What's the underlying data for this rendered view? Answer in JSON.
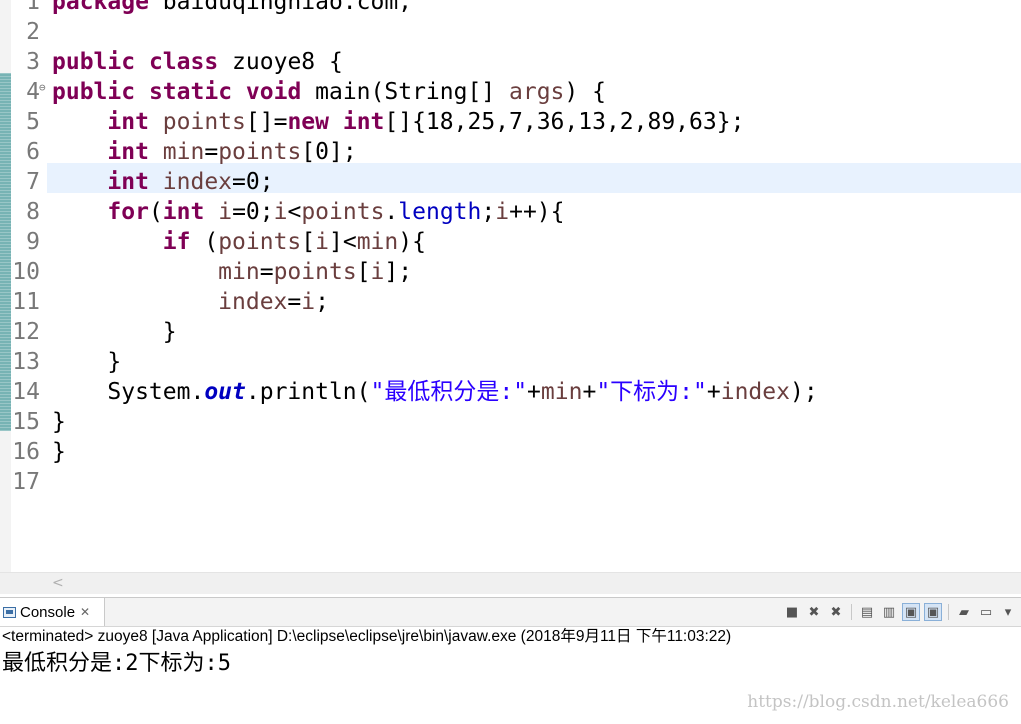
{
  "editor": {
    "lines": [
      {
        "num": "1",
        "tokens": [
          {
            "t": "package",
            "c": "kw"
          },
          {
            "t": " baiduqinghiao.com;",
            "c": "plain"
          }
        ]
      },
      {
        "num": "2",
        "tokens": []
      },
      {
        "num": "3",
        "tokens": [
          {
            "t": "public",
            "c": "kw"
          },
          {
            "t": " ",
            "c": "plain"
          },
          {
            "t": "class",
            "c": "kw"
          },
          {
            "t": " zuoye8 {",
            "c": "plain"
          }
        ]
      },
      {
        "num": "4",
        "fold": true,
        "tokens": [
          {
            "t": "public",
            "c": "kw"
          },
          {
            "t": " ",
            "c": "plain"
          },
          {
            "t": "static",
            "c": "kw"
          },
          {
            "t": " ",
            "c": "plain"
          },
          {
            "t": "void",
            "c": "kw"
          },
          {
            "t": " main(String[] ",
            "c": "plain"
          },
          {
            "t": "args",
            "c": "var"
          },
          {
            "t": ") {",
            "c": "plain"
          }
        ]
      },
      {
        "num": "5",
        "tokens": [
          {
            "t": "    ",
            "c": "plain"
          },
          {
            "t": "int",
            "c": "kw"
          },
          {
            "t": " ",
            "c": "plain"
          },
          {
            "t": "points",
            "c": "var"
          },
          {
            "t": "[]=",
            "c": "plain"
          },
          {
            "t": "new",
            "c": "kw"
          },
          {
            "t": " ",
            "c": "plain"
          },
          {
            "t": "int",
            "c": "kw"
          },
          {
            "t": "[]{18,25,7,36,13,2,89,63};",
            "c": "plain"
          }
        ]
      },
      {
        "num": "6",
        "tokens": [
          {
            "t": "    ",
            "c": "plain"
          },
          {
            "t": "int",
            "c": "kw"
          },
          {
            "t": " ",
            "c": "plain"
          },
          {
            "t": "min",
            "c": "var"
          },
          {
            "t": "=",
            "c": "plain"
          },
          {
            "t": "points",
            "c": "var"
          },
          {
            "t": "[0];",
            "c": "plain"
          }
        ]
      },
      {
        "num": "7",
        "current": true,
        "tokens": [
          {
            "t": "    ",
            "c": "plain"
          },
          {
            "t": "int",
            "c": "kw"
          },
          {
            "t": " ",
            "c": "plain"
          },
          {
            "t": "index",
            "c": "var"
          },
          {
            "t": "=0;",
            "c": "plain"
          }
        ]
      },
      {
        "num": "8",
        "tokens": [
          {
            "t": "    ",
            "c": "plain"
          },
          {
            "t": "for",
            "c": "kw"
          },
          {
            "t": "(",
            "c": "plain"
          },
          {
            "t": "int",
            "c": "kw"
          },
          {
            "t": " ",
            "c": "plain"
          },
          {
            "t": "i",
            "c": "var"
          },
          {
            "t": "=0;",
            "c": "plain"
          },
          {
            "t": "i",
            "c": "var"
          },
          {
            "t": "<",
            "c": "plain"
          },
          {
            "t": "points",
            "c": "var"
          },
          {
            "t": ".",
            "c": "plain"
          },
          {
            "t": "length",
            "c": "field"
          },
          {
            "t": ";",
            "c": "plain"
          },
          {
            "t": "i",
            "c": "var"
          },
          {
            "t": "++){",
            "c": "plain"
          }
        ]
      },
      {
        "num": "9",
        "tokens": [
          {
            "t": "        ",
            "c": "plain"
          },
          {
            "t": "if",
            "c": "kw"
          },
          {
            "t": " (",
            "c": "plain"
          },
          {
            "t": "points",
            "c": "var"
          },
          {
            "t": "[",
            "c": "plain"
          },
          {
            "t": "i",
            "c": "var"
          },
          {
            "t": "]<",
            "c": "plain"
          },
          {
            "t": "min",
            "c": "var"
          },
          {
            "t": "){",
            "c": "plain"
          }
        ]
      },
      {
        "num": "10",
        "tokens": [
          {
            "t": "            ",
            "c": "plain"
          },
          {
            "t": "min",
            "c": "var"
          },
          {
            "t": "=",
            "c": "plain"
          },
          {
            "t": "points",
            "c": "var"
          },
          {
            "t": "[",
            "c": "plain"
          },
          {
            "t": "i",
            "c": "var"
          },
          {
            "t": "];",
            "c": "plain"
          }
        ]
      },
      {
        "num": "11",
        "tokens": [
          {
            "t": "            ",
            "c": "plain"
          },
          {
            "t": "index",
            "c": "var"
          },
          {
            "t": "=",
            "c": "plain"
          },
          {
            "t": "i",
            "c": "var"
          },
          {
            "t": ";",
            "c": "plain"
          }
        ]
      },
      {
        "num": "12",
        "tokens": [
          {
            "t": "        }",
            "c": "plain"
          }
        ]
      },
      {
        "num": "13",
        "tokens": [
          {
            "t": "    }",
            "c": "plain"
          }
        ]
      },
      {
        "num": "14",
        "tokens": [
          {
            "t": "    System.",
            "c": "plain"
          },
          {
            "t": "out",
            "c": "sfield"
          },
          {
            "t": ".println(",
            "c": "plain"
          },
          {
            "t": "\"最低积分是:\"",
            "c": "str"
          },
          {
            "t": "+",
            "c": "plain"
          },
          {
            "t": "min",
            "c": "var"
          },
          {
            "t": "+",
            "c": "plain"
          },
          {
            "t": "\"下标为:\"",
            "c": "str"
          },
          {
            "t": "+",
            "c": "plain"
          },
          {
            "t": "index",
            "c": "var"
          },
          {
            "t": ");",
            "c": "plain"
          }
        ]
      },
      {
        "num": "15",
        "tokens": [
          {
            "t": "}",
            "c": "plain"
          }
        ]
      },
      {
        "num": "16",
        "tokens": [
          {
            "t": "}",
            "c": "plain"
          }
        ]
      },
      {
        "num": "17",
        "tokens": []
      }
    ]
  },
  "console": {
    "tab_label": "Console",
    "status": "<terminated> zuoye8 [Java Application] D:\\eclipse\\eclipse\\jre\\bin\\javaw.exe (2018年9月11日 下午11:03:22)",
    "output_parts": [
      {
        "t": "最低积分是",
        "f": "cjk"
      },
      {
        "t": ":2",
        "f": "mono"
      },
      {
        "t": "下标为",
        "f": "cjk"
      },
      {
        "t": ":5",
        "f": "mono"
      }
    ],
    "toolbar_icons": [
      {
        "name": "terminate-icon",
        "glyph": "■",
        "sep_after": false
      },
      {
        "name": "remove-launch-icon",
        "glyph": "✖",
        "sep_after": false
      },
      {
        "name": "remove-all-terminated-icon",
        "glyph": "✖",
        "sep_after": true
      },
      {
        "name": "clear-console-icon",
        "glyph": "▤",
        "sep_after": false
      },
      {
        "name": "scroll-lock-icon",
        "glyph": "▥",
        "sep_after": false
      },
      {
        "name": "show-on-stdout-icon",
        "glyph": "▣",
        "sep_after": false,
        "selected": true
      },
      {
        "name": "show-on-stderr-icon",
        "glyph": "▣",
        "sep_after": true,
        "selected": true
      },
      {
        "name": "pin-console-icon",
        "glyph": "▰",
        "sep_after": false
      },
      {
        "name": "display-console-icon",
        "glyph": "▭",
        "sep_after": false
      },
      {
        "name": "view-menu-icon",
        "glyph": "▾",
        "sep_after": false
      }
    ]
  },
  "watermark": "https://blog.csdn.net/kelea666"
}
